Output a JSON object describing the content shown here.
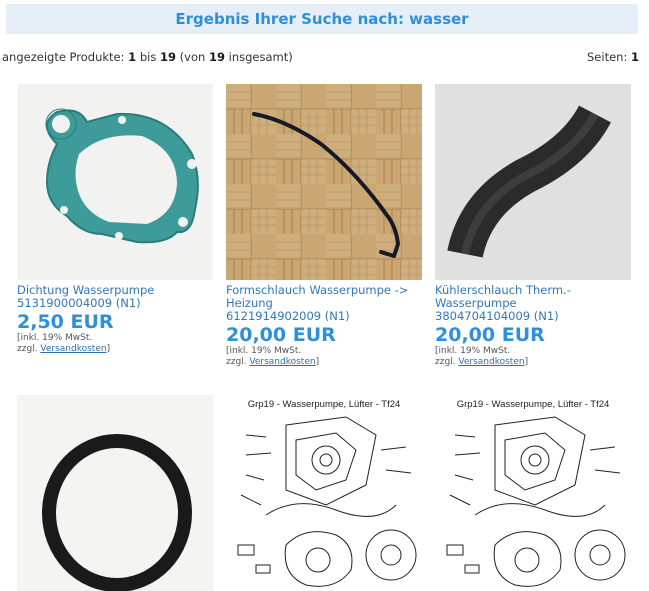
{
  "header": {
    "title": "Ergebnis Ihrer Suche nach: wasser"
  },
  "results_bar": {
    "prefix": "angezeigte Produkte: ",
    "from": "1",
    "to_word": " bis ",
    "to": "19",
    "paren_open": " (von ",
    "total": "19",
    "paren_close": " insgesamt)",
    "pages_label": "Seiten: ",
    "pages_value": "1"
  },
  "products": [
    {
      "title_1": "Dichtung Wasserpumpe",
      "title_2": "5131900004009 (N1)",
      "title_3": "",
      "price": "2,50 EUR",
      "tax": "[inkl. 19% MwSt.",
      "shipping_prefix": "zzgl. ",
      "shipping_link": "Versandkosten",
      "shipping_suffix": "]"
    },
    {
      "title_1": "Formschlauch Wasserpumpe ->",
      "title_2": "Heizung",
      "title_3": "6121914902009 (N1)",
      "price": "20,00 EUR",
      "tax": "[inkl. 19% MwSt.",
      "shipping_prefix": "zzgl. ",
      "shipping_link": "Versandkosten",
      "shipping_suffix": "]"
    },
    {
      "title_1": "Kühlerschlauch Therm.-",
      "title_2": "Wasserpumpe",
      "title_3": "3804704104009 (N1)",
      "price": "20,00 EUR",
      "tax": "[inkl. 19% MwSt.",
      "shipping_prefix": "zzgl. ",
      "shipping_link": "Versandkosten",
      "shipping_suffix": "]"
    },
    {
      "title_1": "",
      "title_2": "",
      "title_3": "",
      "price": "",
      "tax": "",
      "shipping_prefix": "",
      "shipping_link": "",
      "shipping_suffix": ""
    },
    {
      "diagram_caption": "Grp19 - Wasserpumpe, Lüfter - Tf24"
    },
    {
      "diagram_caption": "Grp19 - Wasserpumpe, Lüfter - Tf24"
    }
  ]
}
